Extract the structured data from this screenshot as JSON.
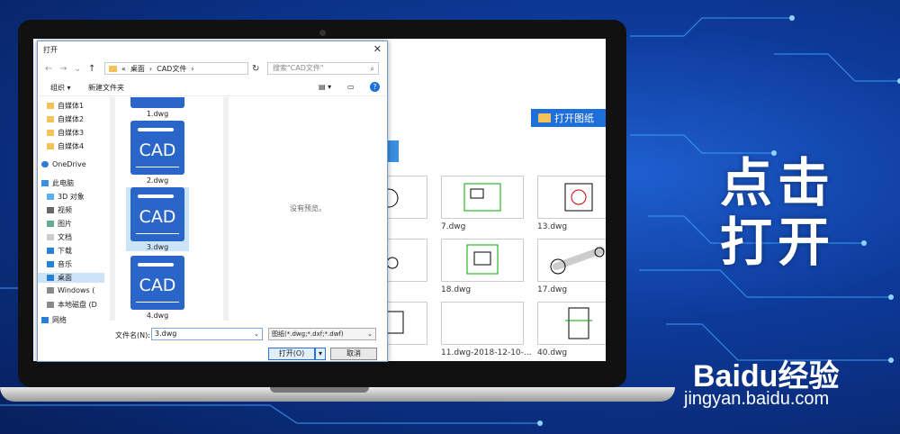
{
  "dialog": {
    "title": "打开",
    "address": {
      "root": "«",
      "crumbs": [
        "桌面",
        "CAD文件"
      ]
    },
    "search_placeholder": "搜索\"CAD文件\"",
    "toolbar": {
      "organize": "组织 ▾",
      "new_folder": "新建文件夹"
    },
    "nav_items": [
      "自媒体1",
      "自媒体2",
      "自媒体3",
      "自媒体4",
      "OneDrive",
      "此电脑",
      "3D 对象",
      "视频",
      "图片",
      "文档",
      "下载",
      "音乐",
      "桌面",
      "Windows (",
      "本地磁盘 (D",
      "网络"
    ],
    "files": [
      {
        "name": "1.dwg"
      },
      {
        "name": "2.dwg"
      },
      {
        "name": "3.dwg",
        "selected": true
      },
      {
        "name": "4.dwg"
      }
    ],
    "cad_text": "CAD",
    "preview_text": "没有预览。",
    "filename_label": "文件名(N):",
    "filename_value": "3.dwg",
    "filter_value": "图纸(*.dwg;*.dxf;*.dwf)",
    "open_button": "打开(O)",
    "cancel_button": "取消"
  },
  "app": {
    "open_drawing_button": "打开图纸",
    "thumbnails": [
      "7.dwg",
      "13.dwg",
      "18.dwg",
      "17.dwg",
      "11.dwg-2018-12-10-...",
      "40.dwg"
    ]
  },
  "caption": {
    "line1": "点击",
    "line2": "打开"
  },
  "watermark": {
    "brand": "Baidu经验",
    "url": "jingyan.baidu.com"
  }
}
